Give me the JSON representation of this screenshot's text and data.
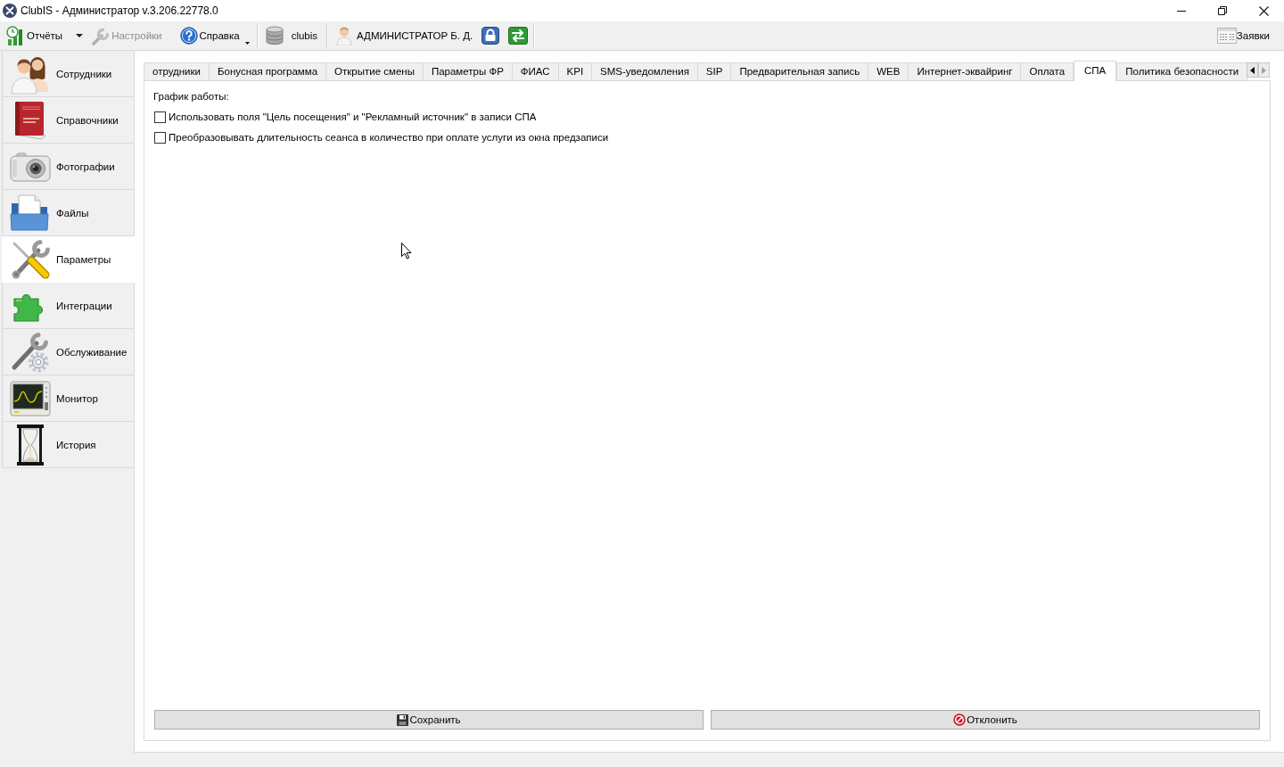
{
  "window": {
    "title": "ClubIS - Администратор v.3.206.22778.0"
  },
  "toolbar": {
    "buttons": [
      {
        "kind": "split",
        "label": "Отчёты",
        "disabled": false
      },
      {
        "kind": "button",
        "label": "Настройки",
        "disabled": true
      },
      {
        "kind": "dropdown",
        "label": "Справка",
        "disabled": false
      }
    ],
    "database": "clubis",
    "user": "АДМИНИСТРАТОР Б. Д.",
    "requests": "Заявки"
  },
  "sidebar": {
    "items": [
      {
        "label": "Сотрудники",
        "selected": false
      },
      {
        "label": "Справочники",
        "selected": false
      },
      {
        "label": "Фотографии",
        "selected": false
      },
      {
        "label": "Файлы",
        "selected": false
      },
      {
        "label": "Параметры",
        "selected": true
      },
      {
        "label": "Интеграции",
        "selected": false
      },
      {
        "label": "Обслуживание",
        "selected": false
      },
      {
        "label": "Монитор",
        "selected": false
      },
      {
        "label": "История",
        "selected": false
      }
    ]
  },
  "tabs": [
    {
      "label": "отрудники",
      "selected": false
    },
    {
      "label": "Бонусная программа",
      "selected": false
    },
    {
      "label": "Открытие смены",
      "selected": false
    },
    {
      "label": "Параметры ФР",
      "selected": false
    },
    {
      "label": "ФИАС",
      "selected": false
    },
    {
      "label": "KPI",
      "selected": false
    },
    {
      "label": "SMS-уведомления",
      "selected": false
    },
    {
      "label": "SIP",
      "selected": false
    },
    {
      "label": "Предварительная запись",
      "selected": false
    },
    {
      "label": "WEB",
      "selected": false
    },
    {
      "label": "Интернет-эквайринг",
      "selected": false
    },
    {
      "label": "Оплата",
      "selected": false
    },
    {
      "label": "СПА",
      "selected": true
    },
    {
      "label": "Политика безопасности",
      "selected": false
    }
  ],
  "tab_scroll": [
    {
      "kind": "left",
      "disabled": false
    },
    {
      "kind": "right",
      "disabled": true
    }
  ],
  "panel": {
    "heading": "График работы:",
    "options": [
      {
        "label": "Использовать поля \"Цель посещения\" и \"Рекламный источник\" в записи СПА",
        "checked": false
      },
      {
        "label": "Преобразовывать длительность сеанса в количество при оплате услуги из окна предзаписи",
        "checked": false
      }
    ]
  },
  "actions": [
    {
      "kind": "save",
      "label": "Сохранить"
    },
    {
      "kind": "cancel",
      "label": "Отклонить"
    }
  ]
}
